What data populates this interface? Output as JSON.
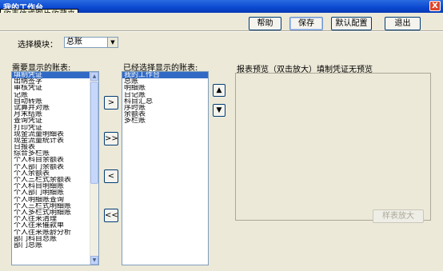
{
  "window": {
    "title": "我的工作台",
    "close_glyph": "X"
  },
  "tooltip": "收表信或图片收藏夹",
  "toolbar": {
    "help": "帮助",
    "save": "保存",
    "default_config": "默认配置",
    "exit": "退出"
  },
  "module_select": {
    "label": "选择模块：",
    "value": "总账",
    "arrow": "▼"
  },
  "left_list": {
    "label": "需要显示的账表:",
    "items": [
      "填制凭证",
      "出纳签字",
      "审核凭证",
      "记账",
      "自动转账",
      "试算并对账",
      "月末结账",
      "查询凭证",
      "打印凭证",
      "现金流量明细表",
      "现金流量统计表",
      "日报表",
      "综合多栏账",
      "个人科目余额表",
      "个人部门余额表",
      "个人余额表",
      "个人三栏式余额表",
      "个人科目明细账",
      "个人部门明细账",
      "个人明细账查询",
      "个人三栏式明细账",
      "个人多栏式明细账",
      "个人往来清理",
      "个人往来催款单",
      "个人往来账龄分析",
      "部门科目总账",
      "部门总账"
    ],
    "selected_index": 0
  },
  "move_buttons": {
    "add": ">",
    "add_all": ">>",
    "remove": "<",
    "remove_all": "<<"
  },
  "right_list": {
    "label": "已经选择显示的账表:",
    "items": [
      "我的工作台",
      "总账",
      "明细账",
      "日记账",
      "科目汇总",
      "序时账",
      "余额表",
      "多栏账"
    ],
    "selected_index": 0
  },
  "order_buttons": {
    "up": "▲",
    "down": "▼"
  },
  "preview": {
    "label": "报表预览（双击放大）",
    "current_label": "填制凭证",
    "status": "无预览",
    "zoom_button": "样表放大"
  },
  "scroll_glyphs": {
    "up": "▲",
    "down": "▼"
  }
}
